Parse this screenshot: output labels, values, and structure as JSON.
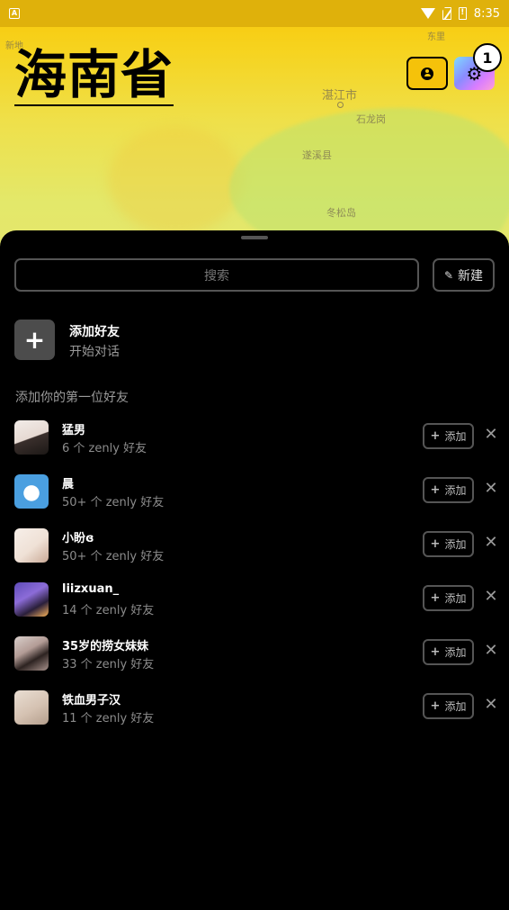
{
  "status_bar": {
    "time": "8:35",
    "left_icon": "A",
    "battery_glyph": "!"
  },
  "map": {
    "region_title": "海南省",
    "places": [
      {
        "label": "湛江市"
      },
      {
        "label": "石龙岗"
      },
      {
        "label": "遂溪县"
      },
      {
        "label": "冬松岛"
      },
      {
        "label": "东里"
      },
      {
        "label": "新地"
      }
    ]
  },
  "header": {
    "profile_icon": "profile-icon",
    "settings_icon": "gear-icon",
    "settings_badge": "1"
  },
  "sheet": {
    "search": {
      "placeholder": "搜索"
    },
    "new_button": {
      "label": "新建",
      "icon": "pencil-icon"
    },
    "add_friend": {
      "title": "添加好友",
      "subtitle": "开始对话",
      "icon": "plus-icon"
    },
    "section_label": "添加你的第一位好友",
    "add_label": "添加",
    "friends": [
      {
        "name": "猛男",
        "count": "6 个 zenly 好友"
      },
      {
        "name": "晨",
        "count": "50+ 个 zenly 好友"
      },
      {
        "name": "小盼ɞ",
        "count": "50+ 个 zenly 好友"
      },
      {
        "name": "liizxuan_",
        "count": "14 个 zenly 好友"
      },
      {
        "name": "35岁的捞女妹妹",
        "count": "33 个 zenly 好友"
      },
      {
        "name": "铁血男子汉",
        "count": "11 个 zenly 好友"
      }
    ]
  }
}
